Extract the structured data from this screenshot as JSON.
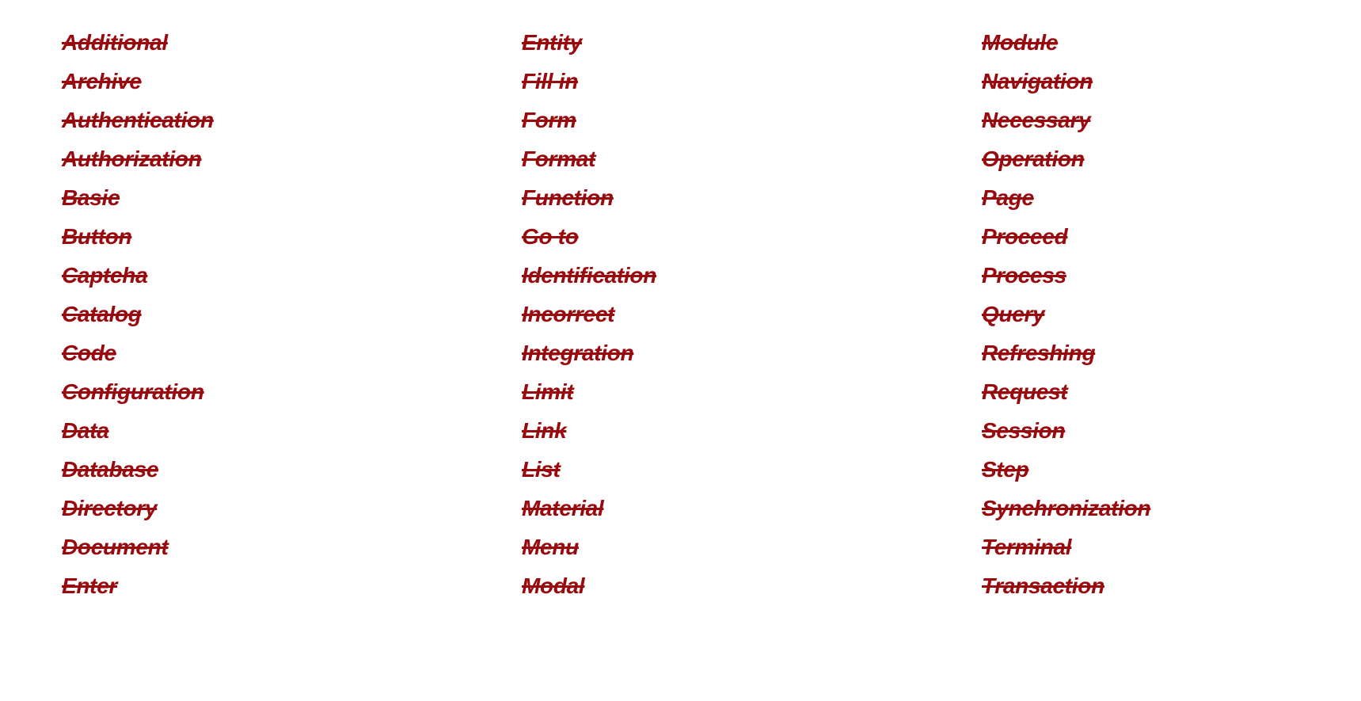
{
  "text_color": "#990a0f",
  "columns": [
    {
      "words": [
        "Additional",
        "Archive",
        "Authentication",
        "Authorization",
        "Basic",
        "Button",
        "Captcha",
        "Catalog",
        "Code",
        "Configuration",
        "Data",
        "Database",
        "Directory",
        "Document",
        "Enter"
      ]
    },
    {
      "words": [
        "Entity",
        "Fill in",
        "Form",
        "Format",
        "Function",
        "Go to",
        "Identification",
        "Incorrect",
        "Integration",
        "Limit",
        "Link",
        "List",
        "Material",
        "Menu",
        "Modal"
      ]
    },
    {
      "words": [
        "Module",
        "Navigation",
        "Necessary",
        "Operation",
        "Page",
        "Proceed",
        "Process",
        "Query",
        "Refreshing",
        "Request",
        "Session",
        "Step",
        "Synchronization",
        "Terminal",
        "Transaction"
      ]
    }
  ]
}
